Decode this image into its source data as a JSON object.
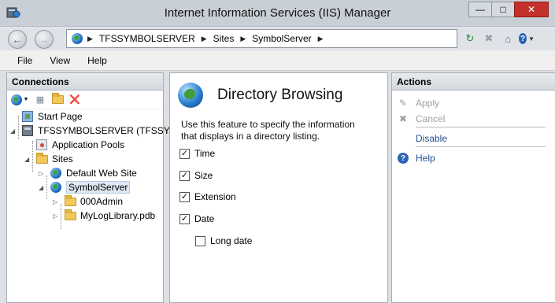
{
  "window": {
    "title": "Internet Information Services (IIS) Manager",
    "buttons": {
      "minimize": "—",
      "maximize": "□",
      "close": "✕"
    }
  },
  "address": {
    "crumbs": [
      "TFSSYMBOLSERVER",
      "Sites",
      "SymbolServer"
    ],
    "separator": "▶"
  },
  "menu": [
    "File",
    "View",
    "Help"
  ],
  "connections": {
    "title": "Connections",
    "tree": [
      {
        "label": "Start Page"
      },
      {
        "label": "TFSSYMBOLSERVER (TFSSYM"
      },
      {
        "label": "Application Pools"
      },
      {
        "label": "Sites"
      },
      {
        "label": "Default Web Site"
      },
      {
        "label": "SymbolServer"
      },
      {
        "label": "000Admin"
      },
      {
        "label": "MyLogLibrary.pdb"
      }
    ]
  },
  "feature": {
    "title": "Directory Browsing",
    "description": "Use this feature to specify the information that displays in a directory listing.",
    "options": [
      {
        "label": "Time",
        "checked": true
      },
      {
        "label": "Size",
        "checked": true
      },
      {
        "label": "Extension",
        "checked": true
      },
      {
        "label": "Date",
        "checked": true
      },
      {
        "label": "Long date",
        "checked": false
      }
    ]
  },
  "actions": {
    "title": "Actions",
    "items": [
      {
        "label": "Apply",
        "enabled": false
      },
      {
        "label": "Cancel",
        "enabled": false
      },
      {
        "label": "Disable",
        "enabled": true
      },
      {
        "label": "Help",
        "enabled": true
      }
    ]
  }
}
